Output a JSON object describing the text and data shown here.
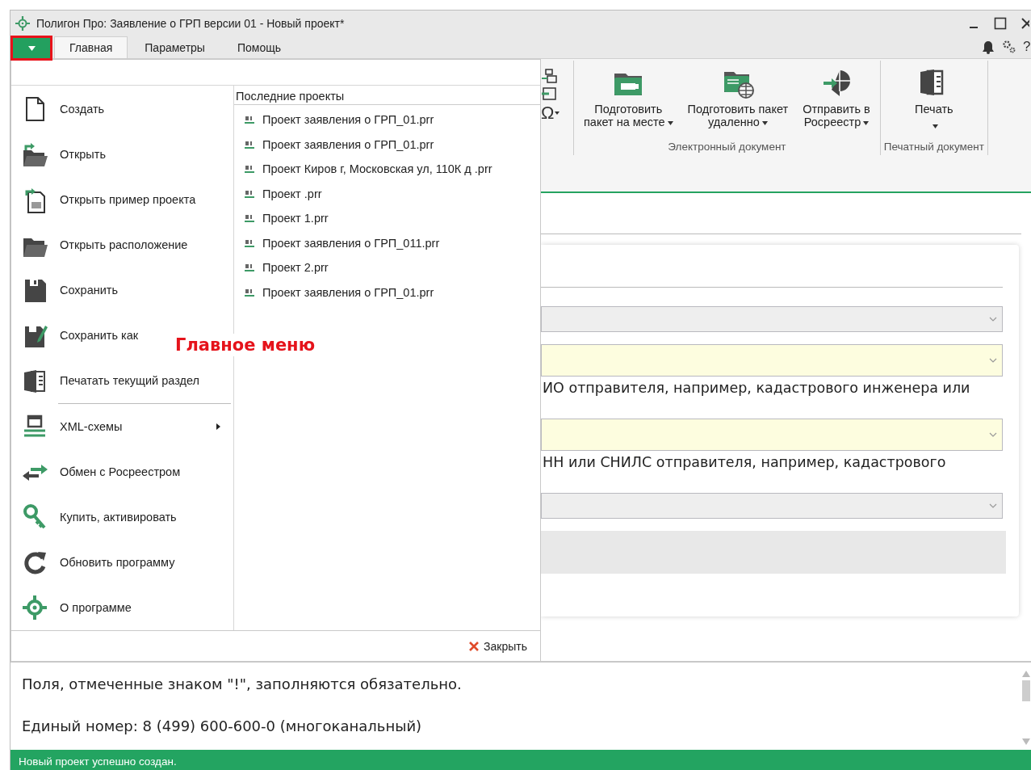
{
  "window": {
    "title": "Полигон Про: Заявление о ГРП версии 01 - Новый проект*"
  },
  "menu_button": {
    "highlighted": true
  },
  "tabs": [
    {
      "label": "Главная",
      "selected": true
    },
    {
      "label": "Параметры",
      "selected": false
    },
    {
      "label": "Помощь",
      "selected": false
    }
  ],
  "help": "?",
  "ribbon": {
    "symbol": "Ω",
    "groups": [
      {
        "label": "Электронный документ",
        "buttons": [
          {
            "label": "Подготовить\nпакет на месте",
            "dropdown": true
          },
          {
            "label": "Подготовить пакет\nудаленно",
            "dropdown": true
          },
          {
            "label": "Отправить в\nРосреестр",
            "dropdown": true
          }
        ]
      },
      {
        "label": "Печатный документ",
        "buttons": [
          {
            "label": "Печать",
            "dropdown": true
          }
        ]
      }
    ]
  },
  "main_menu": {
    "sections": [
      {
        "items": [
          {
            "label": "Создать",
            "kind": "item"
          },
          {
            "label": "Открыть",
            "kind": "item"
          },
          {
            "label": "Открыть пример проекта",
            "kind": "item"
          },
          {
            "label": "Открыть расположение",
            "kind": "item"
          },
          {
            "label": "Сохранить",
            "kind": "item"
          },
          {
            "label": "Сохранить как",
            "kind": "item"
          },
          {
            "label": "Печатать текущий раздел",
            "kind": "item"
          }
        ]
      },
      {
        "items": [
          {
            "label": "XML-схемы",
            "kind": "submenu"
          },
          {
            "label": "Обмен с Росреестром",
            "kind": "item"
          },
          {
            "label": "Купить, активировать",
            "kind": "item"
          },
          {
            "label": "Обновить программу",
            "kind": "item"
          },
          {
            "label": "О программе",
            "kind": "item"
          }
        ]
      }
    ],
    "recent_title": "Последние проекты",
    "recent": [
      "Проект заявления о ГРП_01.prr",
      "Проект заявления о ГРП_01.prr",
      "Проект Киров г, Московская ул, 110К д .prr",
      "Проект .prr",
      "Проект 1.prr",
      "Проект заявления о ГРП_011.prr",
      "Проект 2.prr",
      "Проект заявления о ГРП_01.prr"
    ],
    "close": "Закрыть"
  },
  "annotation": {
    "text": "Главное меню"
  },
  "form": {
    "rows": [
      {
        "kind": "select",
        "required": false
      },
      {
        "kind": "select",
        "required": true
      },
      {
        "kind": "hint",
        "text": "ИО отправителя, например, кадастрового инженера или"
      },
      {
        "kind": "select",
        "required": true
      },
      {
        "kind": "hint",
        "text": "НН или СНИЛС отправителя, например, кадастрового"
      },
      {
        "kind": "select",
        "required": false
      },
      {
        "kind": "panel"
      }
    ]
  },
  "messages": [
    "Поля, отмеченные знаком \"!\", заполняются обязательно.",
    "Единый номер: 8 (499) 600-600-0 (многоканальный)"
  ],
  "status_bar": "Новый проект успешно создан."
}
